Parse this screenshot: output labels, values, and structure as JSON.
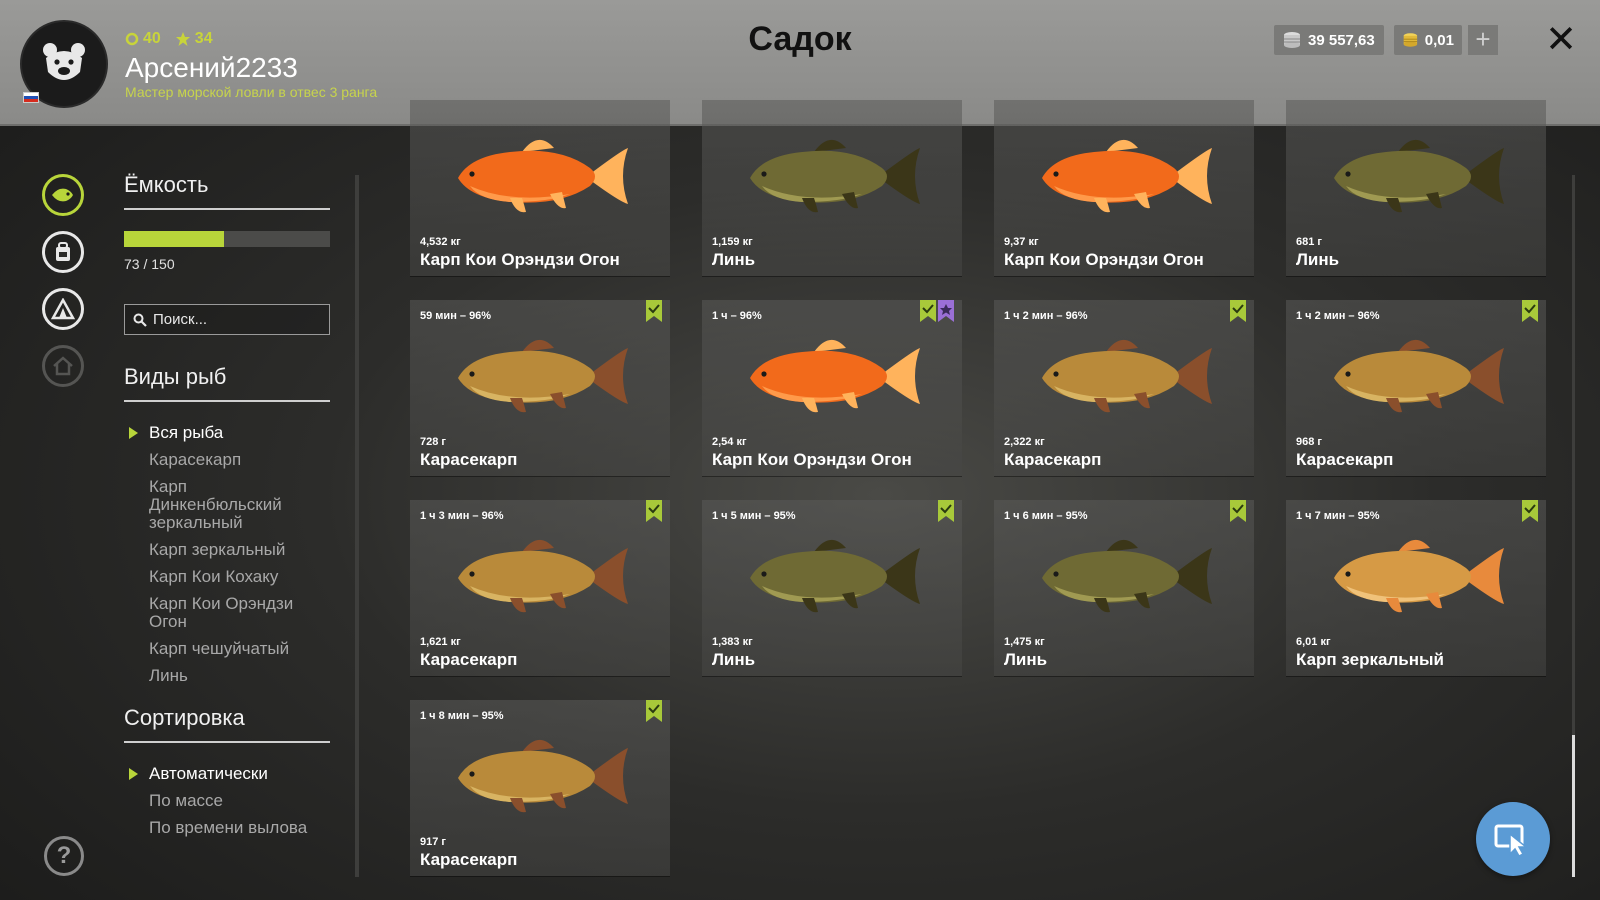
{
  "header": {
    "title": "Садок",
    "username": "Арсений2233",
    "rank": "Мастер морской ловли в отвес 3 ранга",
    "level": "40",
    "stars": "34",
    "silver": "39 557,63",
    "gold": "0,01",
    "plus_label": "+",
    "close_label": "✕"
  },
  "capacity": {
    "title": "Ёмкость",
    "used": 73,
    "total": 150,
    "text": "73 / 150",
    "fill_fraction": 0.487
  },
  "search": {
    "placeholder": "Поиск..."
  },
  "species": {
    "title": "Виды рыб",
    "items": [
      "Вся рыба",
      "Карасекарп",
      "Карп Динкенбюльский зеркальный",
      "Карп зеркальный",
      "Карп Кои Кохаку",
      "Карп Кои Орэндзи Огон",
      "Карп чешуйчатый",
      "Линь"
    ],
    "active_index": 0
  },
  "sort": {
    "title": "Сортировка",
    "items": [
      "Автоматически",
      "По массе",
      "По времени вылова"
    ],
    "active_index": 0
  },
  "help_label": "?",
  "colors": {
    "accent": "#b8d53a",
    "bookmark_green": "#a8c93a",
    "bookmark_purple": "#9a6fd6",
    "koi": "#f26a1b",
    "tench": "#6f6a34",
    "crucian": "#b98a3a",
    "mirror": "#d69a45",
    "cursor_button": "#5b9bd5"
  },
  "fish": [
    {
      "time": "",
      "weight": "4,532 кг",
      "name": "Карп Кои Орэндзи Огон",
      "kind": "koi",
      "bookmarks": []
    },
    {
      "time": "",
      "weight": "1,159 кг",
      "name": "Линь",
      "kind": "tench",
      "bookmarks": []
    },
    {
      "time": "",
      "weight": "9,37 кг",
      "name": "Карп Кои Орэндзи Огон",
      "kind": "koi",
      "bookmarks": []
    },
    {
      "time": "",
      "weight": "681 г",
      "name": "Линь",
      "kind": "tench",
      "bookmarks": []
    },
    {
      "time": "59 мин – 96%",
      "weight": "728 г",
      "name": "Карасекарп",
      "kind": "crucian",
      "bookmarks": [
        "green"
      ]
    },
    {
      "time": "1 ч – 96%",
      "weight": "2,54 кг",
      "name": "Карп Кои Орэндзи Огон",
      "kind": "koi",
      "bookmarks": [
        "green",
        "purple"
      ]
    },
    {
      "time": "1 ч 2 мин – 96%",
      "weight": "2,322 кг",
      "name": "Карасекарп",
      "kind": "crucian",
      "bookmarks": [
        "green"
      ]
    },
    {
      "time": "1 ч 2 мин – 96%",
      "weight": "968 г",
      "name": "Карасекарп",
      "kind": "crucian",
      "bookmarks": [
        "green"
      ]
    },
    {
      "time": "1 ч 3 мин – 96%",
      "weight": "1,621 кг",
      "name": "Карасекарп",
      "kind": "crucian",
      "bookmarks": [
        "green"
      ]
    },
    {
      "time": "1 ч 5 мин – 95%",
      "weight": "1,383 кг",
      "name": "Линь",
      "kind": "tench",
      "bookmarks": [
        "green"
      ]
    },
    {
      "time": "1 ч 6 мин – 95%",
      "weight": "1,475 кг",
      "name": "Линь",
      "kind": "tench",
      "bookmarks": [
        "green"
      ]
    },
    {
      "time": "1 ч 7 мин – 95%",
      "weight": "6,01 кг",
      "name": "Карп зеркальный",
      "kind": "mirror",
      "bookmarks": [
        "green"
      ]
    },
    {
      "time": "1 ч 8 мин – 95%",
      "weight": "917 г",
      "name": "Карасекарп",
      "kind": "crucian",
      "bookmarks": [
        "green"
      ]
    }
  ]
}
